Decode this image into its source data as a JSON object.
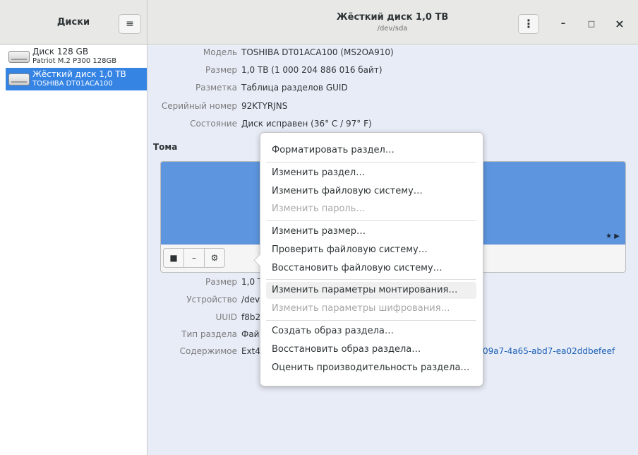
{
  "sidebar": {
    "title": "Диски",
    "menu_icon": "hamburger-menu-icon",
    "disks": [
      {
        "name": "Диск 128 GB",
        "sub": "Patriot M.2 P300 128GB",
        "selected": false
      },
      {
        "name": "Жёсткий диск 1,0 TB",
        "sub": "TOSHIBA DT01ACA100",
        "selected": true
      }
    ]
  },
  "header": {
    "title": "Жёсткий диск 1,0 TB",
    "subtitle": "/dev/sda",
    "kebab": "⋮",
    "minimize": "–",
    "maximize": "□",
    "close": "×"
  },
  "disk_info": [
    {
      "label": "Модель",
      "value": "TOSHIBA DT01ACA100 (MS2OA910)"
    },
    {
      "label": "Размер",
      "value": "1,0 TB (1 000 204 886 016 байт)"
    },
    {
      "label": "Разметка",
      "value": "Таблица разделов GUID"
    },
    {
      "label": "Серийный номер",
      "value": "92KTYRJNS"
    },
    {
      "label": "Состояние",
      "value": "Диск исправен (36° C / 97° F)"
    }
  ],
  "volumes": {
    "title": "Тома",
    "toolbar": [
      "■",
      "–",
      "⚙"
    ],
    "details": [
      {
        "label": "Размер",
        "value": "1,0 TB"
      },
      {
        "label": "Устройство",
        "value": "/dev/sc"
      },
      {
        "label": "UUID",
        "value": "f8b2c8"
      },
      {
        "label": "Тип раздела",
        "value": "Файло"
      },
      {
        "label": "Содержимое",
        "value": "Ext4 (в"
      }
    ],
    "content_link": "09a7-4a65-abd7-ea02ddbefeef"
  },
  "menu": {
    "items": [
      {
        "label": "Форматировать раздел…",
        "disabled": false
      },
      {
        "label": "Изменить раздел…",
        "disabled": false
      },
      {
        "label": "Изменить файловую систему…",
        "disabled": false
      },
      {
        "label": "Изменить пароль…",
        "disabled": true
      },
      {
        "label": "Изменить размер…",
        "disabled": false
      },
      {
        "label": "Проверить файловую систему…",
        "disabled": false
      },
      {
        "label": "Восстановить файловую систему…",
        "disabled": false
      },
      {
        "label": "Изменить параметры монтирования…",
        "disabled": false,
        "highlighted": true
      },
      {
        "label": "Изменить параметры шифрования…",
        "disabled": true
      },
      {
        "label": "Создать образ раздела…",
        "disabled": false
      },
      {
        "label": "Восстановить образ раздела…",
        "disabled": false
      },
      {
        "label": "Оценить производительность раздела…",
        "disabled": false
      }
    ]
  },
  "colors": {
    "accent": "#3584e4",
    "volume_bar": "#5d95de",
    "link": "#1a5fb4"
  }
}
